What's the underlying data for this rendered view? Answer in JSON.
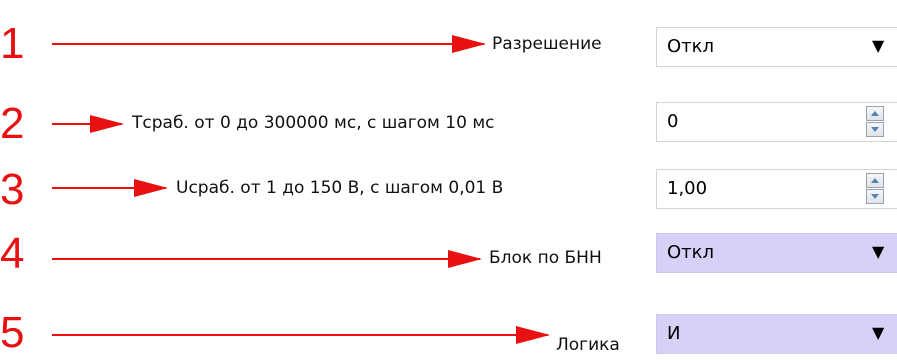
{
  "rows": [
    {
      "num": "1",
      "label": "Разрешение",
      "value": "Откл",
      "control": "select"
    },
    {
      "num": "2",
      "label": "Тсраб. от 0 до 300000 мс, с шагом 10 мс",
      "value": "0",
      "control": "spinbox"
    },
    {
      "num": "3",
      "label": "Uсраб. от 1 до 150 В, с шагом 0,01 В",
      "value": "1,00",
      "control": "spinbox"
    },
    {
      "num": "4",
      "label": "Блок по БНН",
      "value": "Откл",
      "control": "select"
    },
    {
      "num": "5",
      "label": "Логика",
      "value": "И",
      "control": "select"
    }
  ],
  "icons": {
    "dropdown": "caret-down-icon",
    "spin_up": "spin-up-icon",
    "spin_down": "spin-down-icon"
  },
  "colors": {
    "annotation": "#e81010",
    "highlight": "#d8d0f6"
  }
}
